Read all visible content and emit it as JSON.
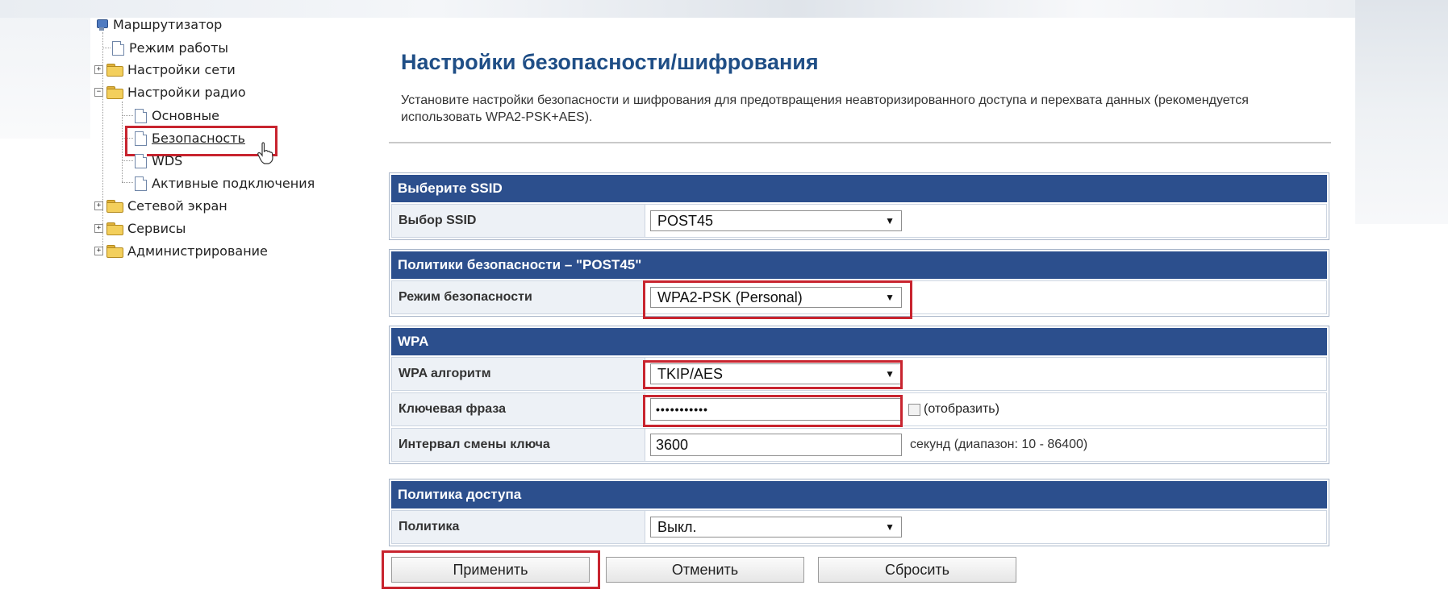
{
  "tree": {
    "root": "Маршрутизатор",
    "items": [
      {
        "label": "Режим работы",
        "type": "doc"
      },
      {
        "label": "Настройки сети",
        "type": "folder",
        "expander": "+"
      },
      {
        "label": "Настройки радио",
        "type": "folder",
        "expander": "−"
      },
      {
        "label": "Основные",
        "type": "doc"
      },
      {
        "label": "Безопасность",
        "type": "doc",
        "selected": true
      },
      {
        "label": "WDS",
        "type": "doc"
      },
      {
        "label": "Активные подключения",
        "type": "doc"
      },
      {
        "label": "Сетевой экран",
        "type": "folder",
        "expander": "+"
      },
      {
        "label": "Сервисы",
        "type": "folder",
        "expander": "+"
      },
      {
        "label": "Администрирование",
        "type": "folder",
        "expander": "+"
      }
    ]
  },
  "page": {
    "title": "Настройки безопасности/шифрования",
    "description": "Установите настройки безопасности и шифрования для предотвращения неавторизированного доступа и перехвата данных (рекомендуется использовать WPA2-PSK+AES)."
  },
  "sections": {
    "ssid": {
      "header": "Выберите SSID",
      "label": "Выбор SSID",
      "value": "POST45"
    },
    "policy": {
      "header": "Политики безопасности – \"POST45\"",
      "label": "Режим безопасности",
      "value": "WPA2-PSK (Personal)"
    },
    "wpa": {
      "header": "WPA",
      "algo_label": "WPA алгоритм",
      "algo_value": "TKIP/AES",
      "key_label": "Ключевая фраза",
      "key_value": "•••••••••••",
      "show_label": "(отобразить)",
      "interval_label": "Интервал смены ключа",
      "interval_value": "3600",
      "interval_hint": "секунд (диапазон: 10 - 86400)"
    },
    "access": {
      "header": "Политика доступа",
      "label": "Политика",
      "value": "Выкл."
    }
  },
  "buttons": {
    "apply": "Применить",
    "cancel": "Отменить",
    "reset": "Сбросить"
  },
  "colors": {
    "header_bg": "#2c4f8d",
    "title": "#1f4e86",
    "highlight": "#c8242f"
  }
}
